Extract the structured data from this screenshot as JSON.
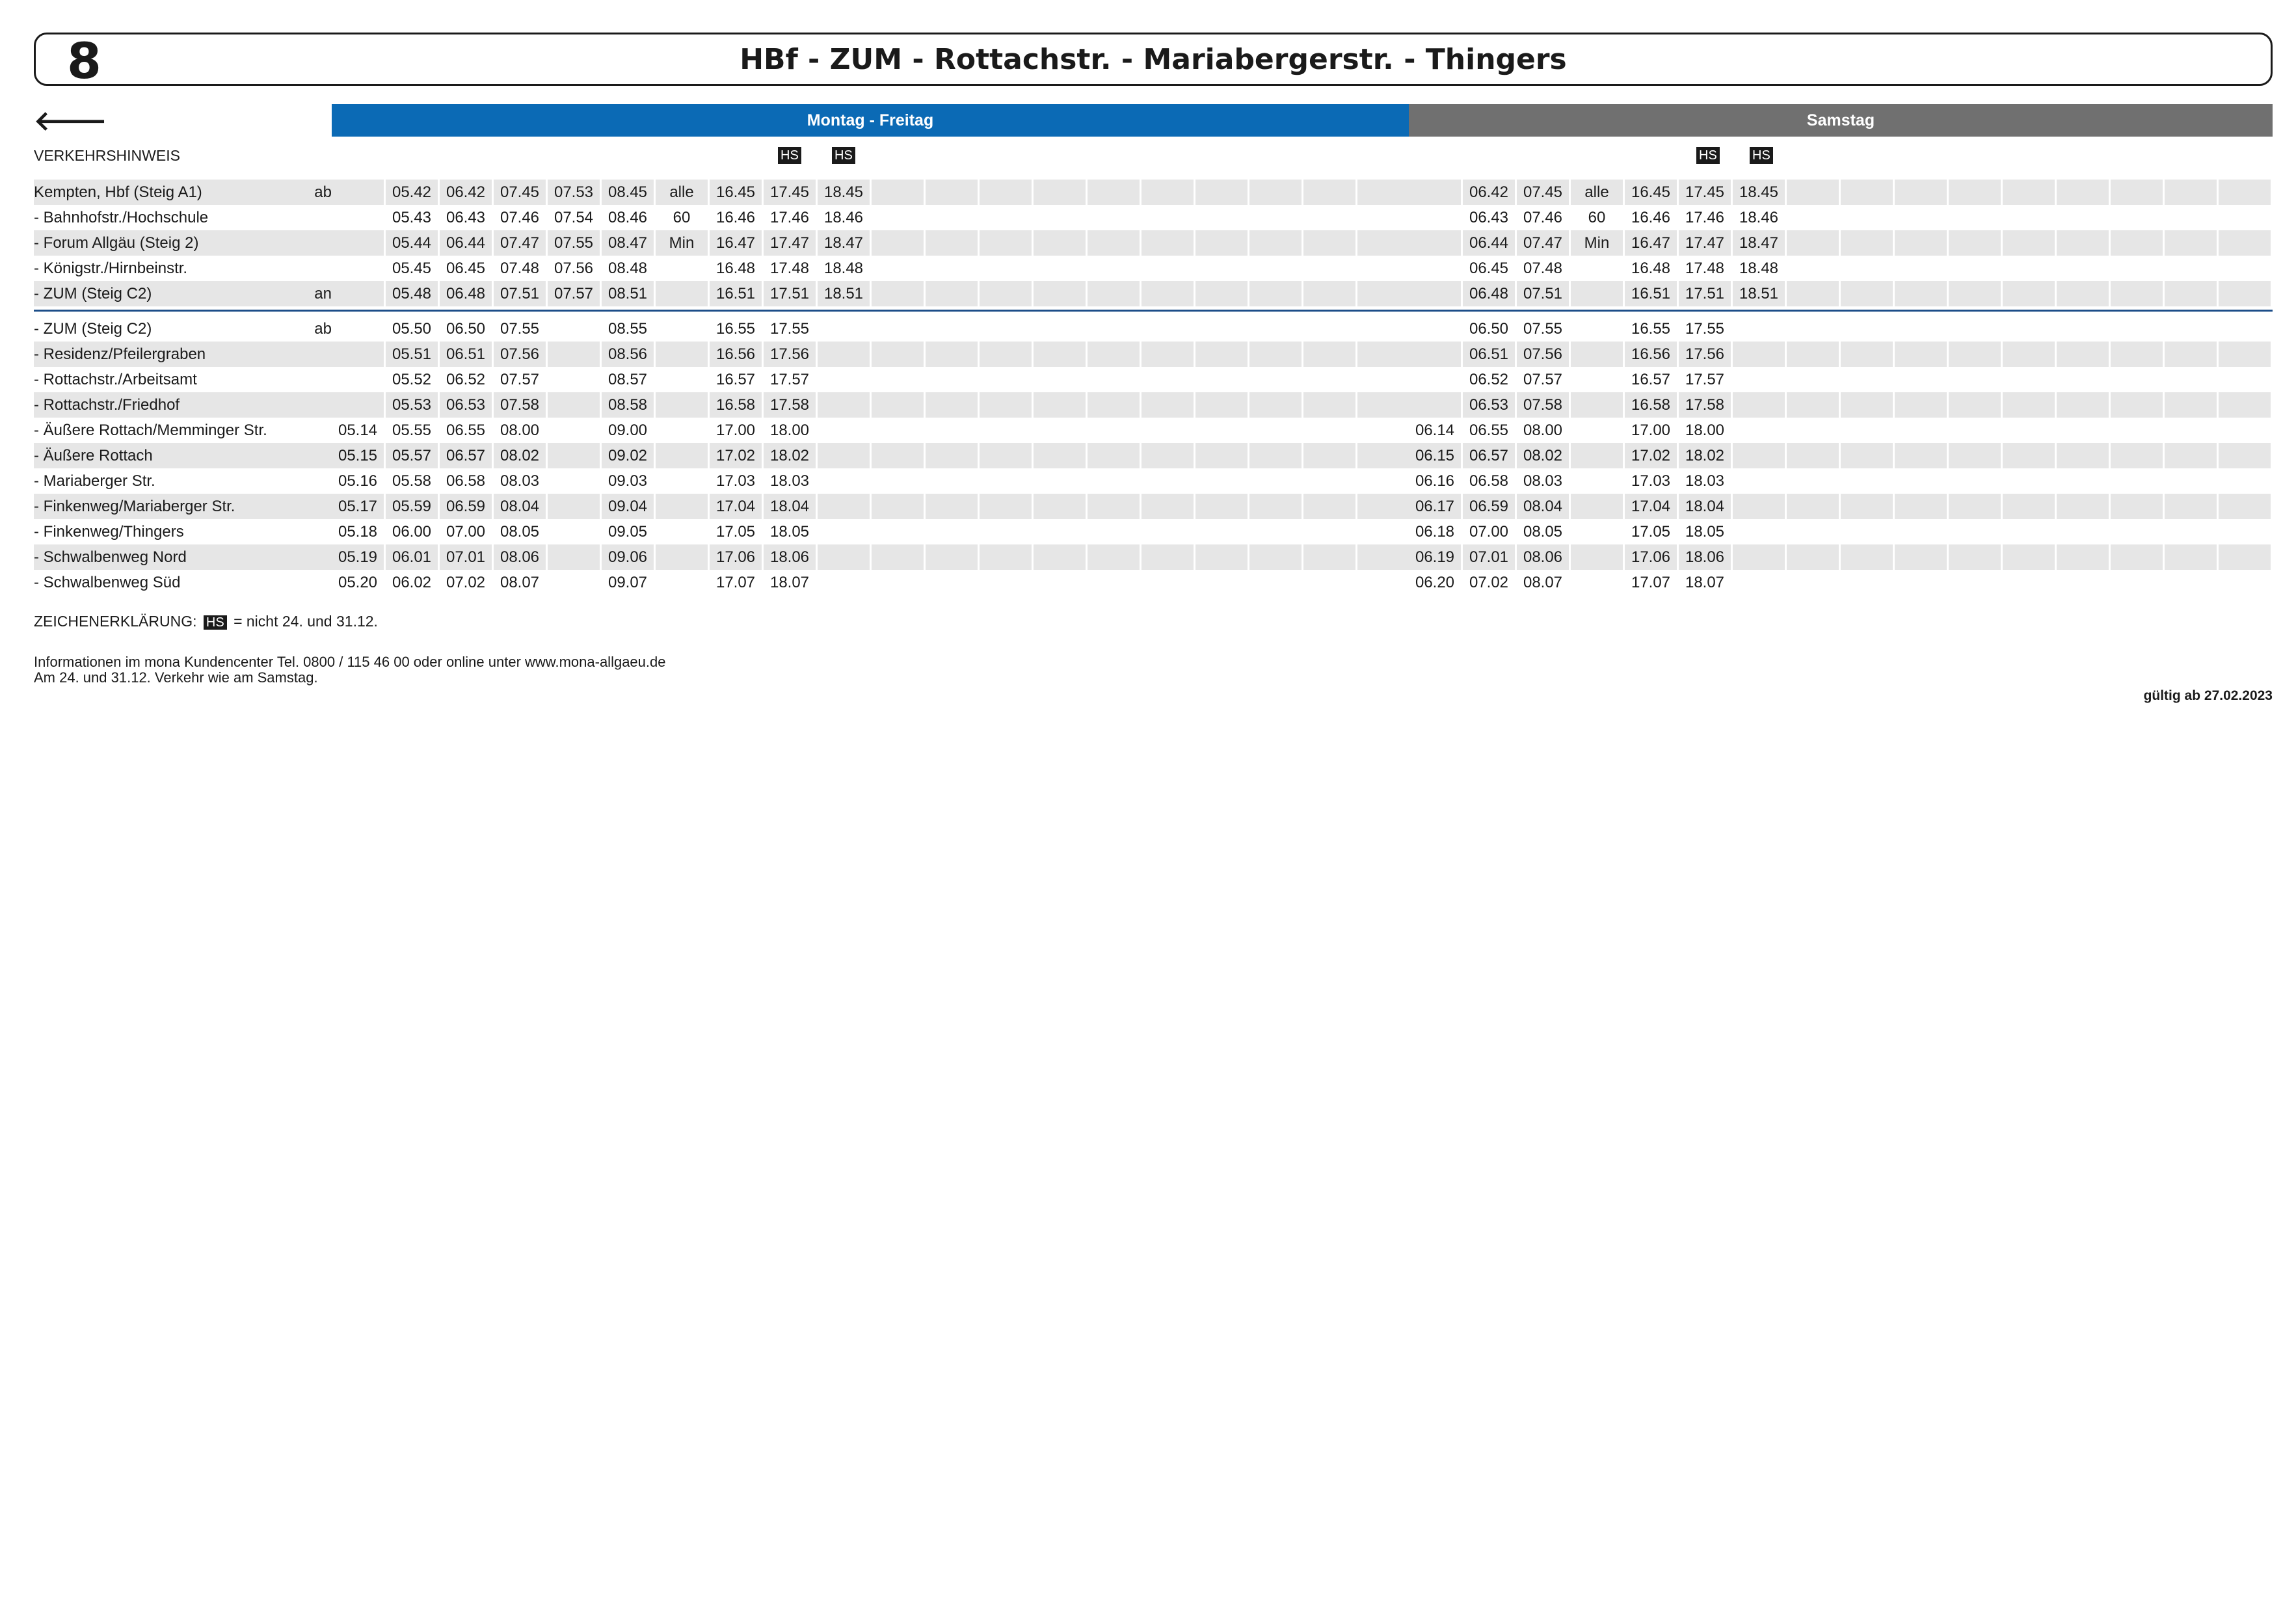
{
  "header": {
    "line": "8",
    "title": "HBf - ZUM - Rottachstr. - Mariabergerstr. - Thingers"
  },
  "back_arrow": "🡐",
  "bands": {
    "weekday": "Montag - Freitag",
    "saturday": "Samstag"
  },
  "notice_label": "VERKEHRSHINWEIS",
  "hs_mark": "HS",
  "stops": [
    {
      "name": "Kempten, Hbf (Steig A1)",
      "dir": "ab",
      "mf": [
        "",
        "05.42",
        "06.42",
        "07.45",
        "07.53",
        "08.45",
        "alle",
        "16.45",
        "17.45",
        "18.45"
      ],
      "sa": [
        "",
        "06.42",
        "07.45",
        "alle",
        "16.45",
        "17.45",
        "18.45"
      ]
    },
    {
      "name": "- Bahnhofstr./Hochschule",
      "dir": "",
      "mf": [
        "",
        "05.43",
        "06.43",
        "07.46",
        "07.54",
        "08.46",
        "60",
        "16.46",
        "17.46",
        "18.46"
      ],
      "sa": [
        "",
        "06.43",
        "07.46",
        "60",
        "16.46",
        "17.46",
        "18.46"
      ]
    },
    {
      "name": "- Forum Allgäu (Steig 2)",
      "dir": "",
      "mf": [
        "",
        "05.44",
        "06.44",
        "07.47",
        "07.55",
        "08.47",
        "Min",
        "16.47",
        "17.47",
        "18.47"
      ],
      "sa": [
        "",
        "06.44",
        "07.47",
        "Min",
        "16.47",
        "17.47",
        "18.47"
      ]
    },
    {
      "name": "- Königstr./Hirnbeinstr.",
      "dir": "",
      "mf": [
        "",
        "05.45",
        "06.45",
        "07.48",
        "07.56",
        "08.48",
        "",
        "16.48",
        "17.48",
        "18.48"
      ],
      "sa": [
        "",
        "06.45",
        "07.48",
        "",
        "16.48",
        "17.48",
        "18.48"
      ]
    },
    {
      "name": "- ZUM (Steig C2)",
      "dir": "an",
      "mf": [
        "",
        "05.48",
        "06.48",
        "07.51",
        "07.57",
        "08.51",
        "",
        "16.51",
        "17.51",
        "18.51"
      ],
      "sa": [
        "",
        "06.48",
        "07.51",
        "",
        "16.51",
        "17.51",
        "18.51"
      ]
    },
    {
      "name": "- ZUM (Steig C2)",
      "dir": "ab",
      "mf": [
        "",
        "05.50",
        "06.50",
        "07.55",
        "",
        "08.55",
        "",
        "16.55",
        "17.55",
        ""
      ],
      "sa": [
        "",
        "06.50",
        "07.55",
        "",
        "16.55",
        "17.55",
        ""
      ]
    },
    {
      "name": "- Residenz/Pfeilergraben",
      "dir": "",
      "mf": [
        "",
        "05.51",
        "06.51",
        "07.56",
        "",
        "08.56",
        "",
        "16.56",
        "17.56",
        ""
      ],
      "sa": [
        "",
        "06.51",
        "07.56",
        "",
        "16.56",
        "17.56",
        ""
      ]
    },
    {
      "name": "- Rottachstr./Arbeitsamt",
      "dir": "",
      "mf": [
        "",
        "05.52",
        "06.52",
        "07.57",
        "",
        "08.57",
        "",
        "16.57",
        "17.57",
        ""
      ],
      "sa": [
        "",
        "06.52",
        "07.57",
        "",
        "16.57",
        "17.57",
        ""
      ]
    },
    {
      "name": "- Rottachstr./Friedhof",
      "dir": "",
      "mf": [
        "",
        "05.53",
        "06.53",
        "07.58",
        "",
        "08.58",
        "",
        "16.58",
        "17.58",
        ""
      ],
      "sa": [
        "",
        "06.53",
        "07.58",
        "",
        "16.58",
        "17.58",
        ""
      ]
    },
    {
      "name": "- Äußere Rottach/Memminger Str.",
      "dir": "",
      "mf": [
        "05.14",
        "05.55",
        "06.55",
        "08.00",
        "",
        "09.00",
        "",
        "17.00",
        "18.00",
        ""
      ],
      "sa": [
        "06.14",
        "06.55",
        "08.00",
        "",
        "17.00",
        "18.00",
        ""
      ]
    },
    {
      "name": "- Äußere Rottach",
      "dir": "",
      "mf": [
        "05.15",
        "05.57",
        "06.57",
        "08.02",
        "",
        "09.02",
        "",
        "17.02",
        "18.02",
        ""
      ],
      "sa": [
        "06.15",
        "06.57",
        "08.02",
        "",
        "17.02",
        "18.02",
        ""
      ]
    },
    {
      "name": "- Mariaberger Str.",
      "dir": "",
      "mf": [
        "05.16",
        "05.58",
        "06.58",
        "08.03",
        "",
        "09.03",
        "",
        "17.03",
        "18.03",
        ""
      ],
      "sa": [
        "06.16",
        "06.58",
        "08.03",
        "",
        "17.03",
        "18.03",
        ""
      ]
    },
    {
      "name": "- Finkenweg/Mariaberger Str.",
      "dir": "",
      "mf": [
        "05.17",
        "05.59",
        "06.59",
        "08.04",
        "",
        "09.04",
        "",
        "17.04",
        "18.04",
        ""
      ],
      "sa": [
        "06.17",
        "06.59",
        "08.04",
        "",
        "17.04",
        "18.04",
        ""
      ]
    },
    {
      "name": "- Finkenweg/Thingers",
      "dir": "",
      "mf": [
        "05.18",
        "06.00",
        "07.00",
        "08.05",
        "",
        "09.05",
        "",
        "17.05",
        "18.05",
        ""
      ],
      "sa": [
        "06.18",
        "07.00",
        "08.05",
        "",
        "17.05",
        "18.05",
        ""
      ]
    },
    {
      "name": "- Schwalbenweg Nord",
      "dir": "",
      "mf": [
        "05.19",
        "06.01",
        "07.01",
        "08.06",
        "",
        "09.06",
        "",
        "17.06",
        "18.06",
        ""
      ],
      "sa": [
        "06.19",
        "07.01",
        "08.06",
        "",
        "17.06",
        "18.06",
        ""
      ]
    },
    {
      "name": "- Schwalbenweg Süd",
      "dir": "",
      "mf": [
        "05.20",
        "06.02",
        "07.02",
        "08.07",
        "",
        "09.07",
        "",
        "17.07",
        "18.07",
        ""
      ],
      "sa": [
        "06.20",
        "07.02",
        "08.07",
        "",
        "17.07",
        "18.07",
        ""
      ]
    }
  ],
  "legend": {
    "label": "ZEICHENERKLÄRUNG:",
    "mark": "HS",
    "text": "= nicht 24. und 31.12."
  },
  "info": {
    "line1": "Informationen im mona Kundencenter Tel. 0800 / 115 46 00 oder online unter www.mona-allgaeu.de",
    "line2": "Am 24. und 31.12. Verkehr wie am Samstag."
  },
  "valid_from": "gültig ab 27.02.2023"
}
